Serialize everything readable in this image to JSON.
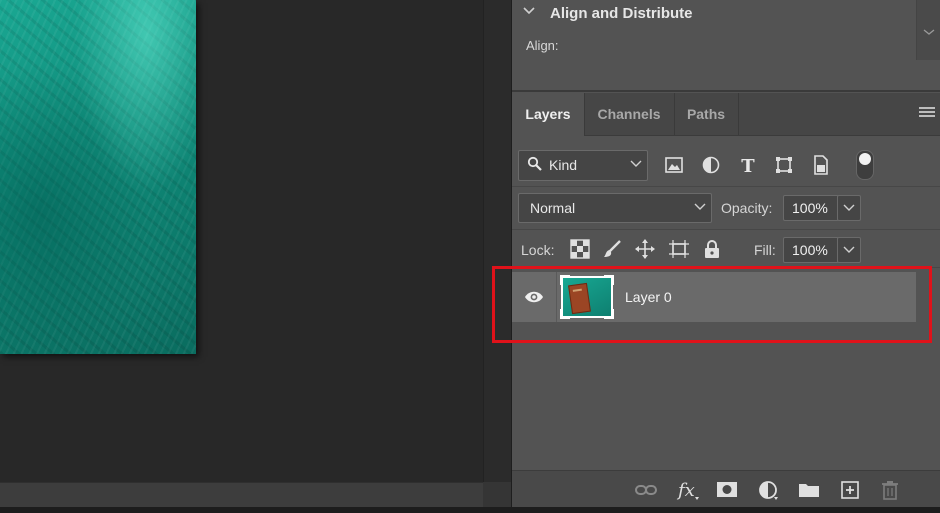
{
  "align_panel": {
    "title": "Align and Distribute",
    "align_label": "Align:"
  },
  "tabs": [
    {
      "label": "Layers",
      "active": true
    },
    {
      "label": "Channels",
      "active": false
    },
    {
      "label": "Paths",
      "active": false
    }
  ],
  "filter": {
    "kind_label": "Kind",
    "icons": [
      "image-filter-icon",
      "adjustment-filter-icon",
      "type-filter-icon",
      "shape-filter-icon",
      "smart-object-filter-icon"
    ],
    "toggle_on": true
  },
  "blend": {
    "mode": "Normal",
    "opacity_label": "Opacity:",
    "opacity_value": "100%"
  },
  "lock": {
    "label": "Lock:",
    "icons": [
      "lock-transparent-pixels-icon",
      "lock-image-pixels-icon",
      "lock-position-icon",
      "lock-artboard-icon",
      "lock-all-icon"
    ],
    "fill_label": "Fill:",
    "fill_value": "100%"
  },
  "layers": [
    {
      "name": "Layer 0",
      "visible": true,
      "selected": true
    }
  ],
  "footer_icons": [
    "link-layers-icon",
    "fx-icon",
    "mask-icon",
    "adjustment-layer-icon",
    "group-folder-icon",
    "new-layer-icon",
    "delete-layer-icon"
  ],
  "colors": {
    "panel_bg": "#535353",
    "selected_layer": "#6a6a6a",
    "highlight_box": "#e0121a",
    "canvas_teal": "#0f8c7a"
  }
}
